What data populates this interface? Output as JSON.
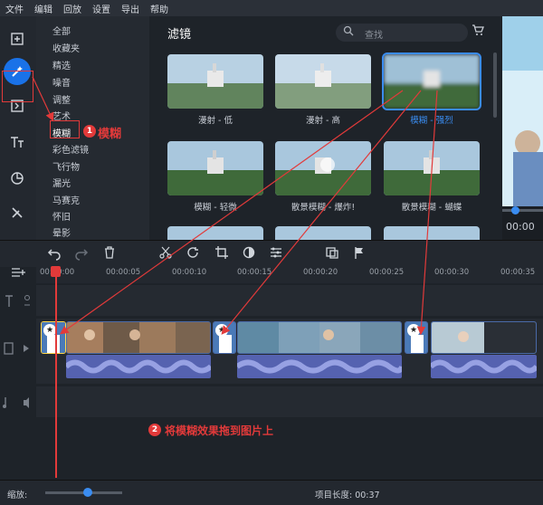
{
  "menu": [
    "文件",
    "编辑",
    "回放",
    "设置",
    "导出",
    "帮助"
  ],
  "categories": [
    "全部",
    "收藏夹",
    "精选",
    "噪音",
    "调整",
    "艺术",
    "模糊",
    "彩色滤镜",
    "飞行物",
    "漏光",
    "马赛克",
    "怀旧",
    "晕影"
  ],
  "filters": {
    "title": "滤镜",
    "search_placeholder": "查找",
    "items": [
      "漫射 - 低",
      "漫射 - 高",
      "模糊 - 强烈",
      "模糊 - 轻微",
      "散景模糊 - 爆炸!",
      "散景模糊 - 蝴蝶"
    ]
  },
  "preview": {
    "time": "00:00"
  },
  "timeline": {
    "ticks": [
      "00:00:00",
      "00:00:05",
      "00:00:10",
      "00:00:15",
      "00:00:20",
      "00:00:25",
      "00:00:30",
      "00:00:35"
    ]
  },
  "annotations": {
    "step1_number": "1",
    "step1_text": "模糊",
    "step2_number": "2",
    "step2_text": "将模糊效果拖到图片上"
  },
  "status": {
    "zoom_label": "缩放:",
    "project_length": "项目长度: 00:37"
  },
  "colors": {
    "accent": "#1a72e8",
    "annotation": "#e23a3a",
    "audio": "#5562b0"
  }
}
